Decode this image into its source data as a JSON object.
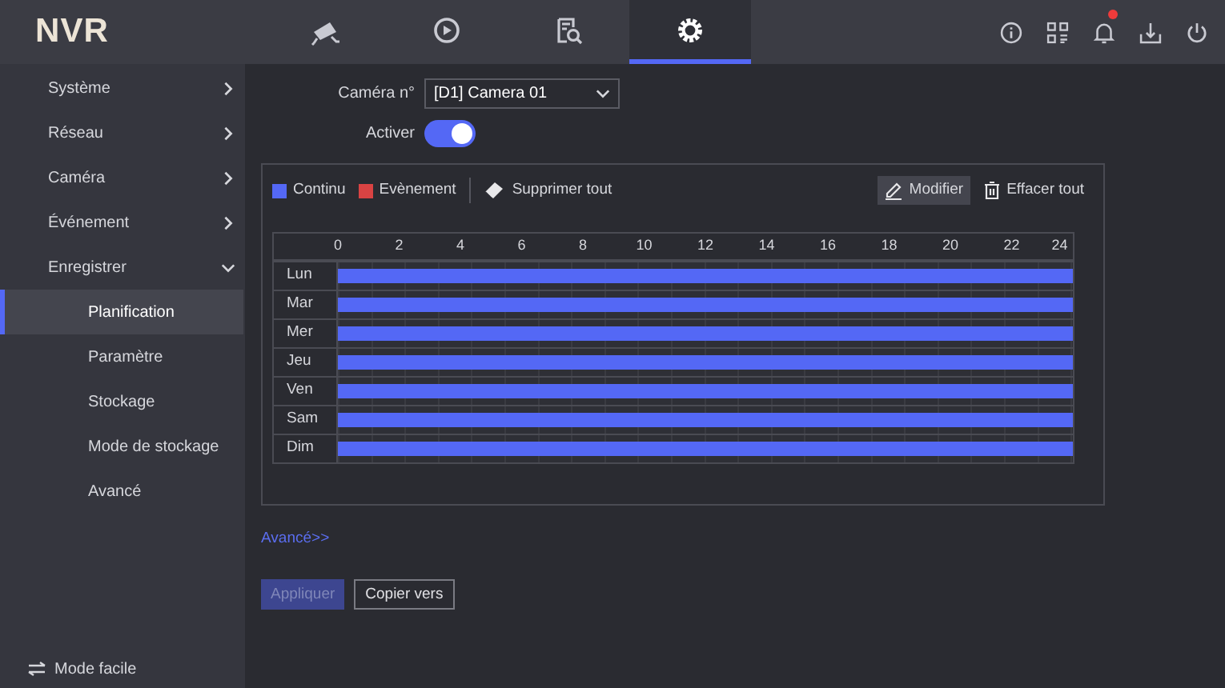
{
  "header": {
    "logo": "NVR",
    "nav_tabs": [
      {
        "kind": "camera",
        "selected": false
      },
      {
        "kind": "playback",
        "selected": false
      },
      {
        "kind": "search",
        "selected": false
      },
      {
        "kind": "settings",
        "selected": true
      }
    ],
    "tools": [
      {
        "kind": "info"
      },
      {
        "kind": "qr"
      },
      {
        "kind": "bell",
        "alert": true
      },
      {
        "kind": "export"
      },
      {
        "kind": "power"
      }
    ]
  },
  "sidebar": {
    "items": [
      {
        "label": "Système",
        "expanded": false,
        "selected": false
      },
      {
        "label": "Réseau",
        "expanded": false,
        "selected": false
      },
      {
        "label": "Caméra",
        "expanded": false,
        "selected": false
      },
      {
        "label": "Événement",
        "expanded": false,
        "selected": false
      },
      {
        "label": "Enregistrer",
        "expanded": true,
        "selected": false,
        "children": [
          {
            "label": "Planification",
            "selected": true
          },
          {
            "label": "Paramètre",
            "selected": false
          },
          {
            "label": "Stockage",
            "selected": false
          },
          {
            "label": "Mode de stockage",
            "selected": false
          },
          {
            "label": "Avancé",
            "selected": false
          }
        ]
      }
    ],
    "footer": "Mode facile"
  },
  "camera_field": {
    "label": "Caméra n°",
    "value": "[D1] Camera 01"
  },
  "enable": {
    "label": "Activer",
    "on": true
  },
  "legend": [
    {
      "label": "Continu",
      "color": "#5468f5"
    },
    {
      "label": "Evènement",
      "color": "#d94343"
    }
  ],
  "toolbar": {
    "delete_all": "Supprimer tout",
    "edit": {
      "label": "Modifier",
      "selected": true
    },
    "clear_all": "Effacer tout"
  },
  "schedule": {
    "hours": [
      "0",
      "2",
      "4",
      "6",
      "8",
      "10",
      "12",
      "14",
      "16",
      "18",
      "20",
      "22",
      "24"
    ],
    "days": [
      {
        "label": "Lun",
        "continuous_all_day": true
      },
      {
        "label": "Mar",
        "continuous_all_day": true
      },
      {
        "label": "Mer",
        "continuous_all_day": true
      },
      {
        "label": "Jeu",
        "continuous_all_day": true
      },
      {
        "label": "Ven",
        "continuous_all_day": true
      },
      {
        "label": "Sam",
        "continuous_all_day": true
      },
      {
        "label": "Dim",
        "continuous_all_day": true
      }
    ]
  },
  "advanced_link": "Avancé>>",
  "buttons": [
    {
      "label": "Appliquer",
      "kind": "primary",
      "disabled": true
    },
    {
      "label": "Copier vers",
      "kind": "secondary",
      "disabled": false
    }
  ]
}
